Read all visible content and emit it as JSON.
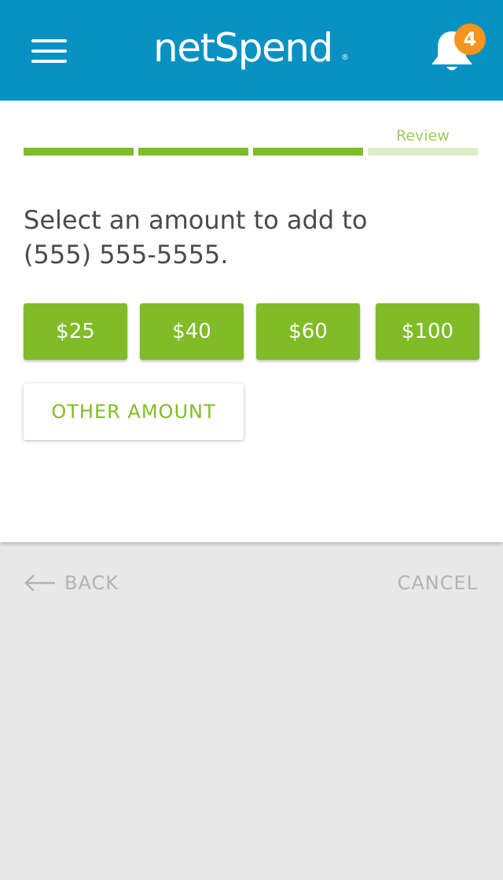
{
  "header": {
    "brand": "netSpend",
    "brand_mark": "®",
    "notification_count": "4",
    "menu_icon": "hamburger-menu-icon",
    "bell_icon": "bell-icon"
  },
  "progress": {
    "steps_total": 4,
    "steps_completed": 3,
    "current_step_label": "Review"
  },
  "main": {
    "prompt_line1": "Select an amount to add to",
    "prompt_line2": "(555) 555-5555.",
    "amounts": [
      "$25",
      "$40",
      "$60",
      "$100"
    ],
    "other_amount_label": "OTHER AMOUNT"
  },
  "footer": {
    "back_label": "BACK",
    "back_icon": "arrow-left-icon",
    "cancel_label": "CANCEL"
  },
  "colors": {
    "header_bg": "#0892c4",
    "accent_green": "#80bc27",
    "badge_orange": "#f7941d",
    "page_bg": "#e8e8e8"
  }
}
